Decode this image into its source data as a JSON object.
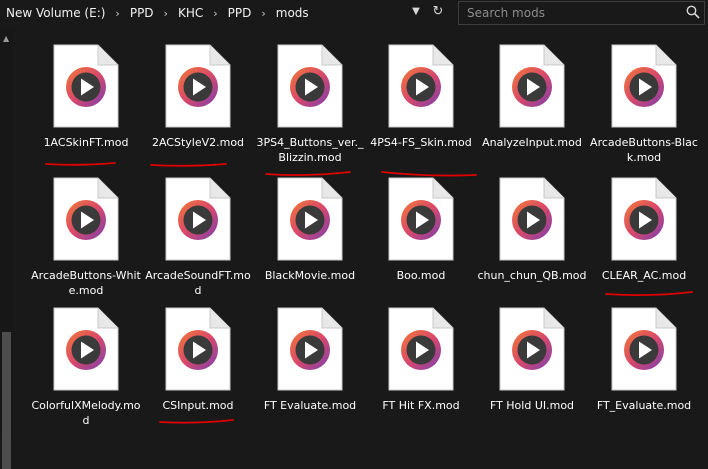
{
  "address_bar": {
    "crumbs": [
      "New Volume (E:)",
      "PPD",
      "KHC",
      "PPD",
      "mods"
    ],
    "dropdown_icon": "chevron-down-icon",
    "refresh_icon": "refresh-icon"
  },
  "search": {
    "placeholder": "Search mods",
    "icon": "search-icon"
  },
  "files": [
    {
      "label": "1ACSkinFT.mod",
      "underlined": true
    },
    {
      "label": "2ACStyleV2.mod",
      "underlined": true
    },
    {
      "label": "3PS4_Buttons_ver._Blizzin.mod",
      "underlined": true
    },
    {
      "label": "4PS4-FS_Skin.mod",
      "underlined": true
    },
    {
      "label": "AnalyzeInput.mod",
      "underlined": false
    },
    {
      "label": "ArcadeButtons-Black.mod",
      "underlined": false
    },
    {
      "label": "ArcadeButtons-White.mod",
      "underlined": false
    },
    {
      "label": "ArcadeSoundFT.mod",
      "underlined": false
    },
    {
      "label": "BlackMovie.mod",
      "underlined": false
    },
    {
      "label": "Boo.mod",
      "underlined": false
    },
    {
      "label": "chun_chun_QB.mod",
      "underlined": false
    },
    {
      "label": "CLEAR_AC.mod",
      "underlined": true
    },
    {
      "label": "ColorfulXMelody.mod",
      "underlined": false
    },
    {
      "label": "CSInput.mod",
      "underlined": true
    },
    {
      "label": "FT Evaluate.mod",
      "underlined": false
    },
    {
      "label": "FT Hit FX.mod",
      "underlined": false
    },
    {
      "label": "FT Hold UI.mod",
      "underlined": false
    },
    {
      "label": "FT_Evaluate.mod",
      "underlined": false
    }
  ],
  "file_icon": "media-file-icon",
  "colors": {
    "background": "#191919",
    "annotation": "#e00000",
    "icon_ring_orange": "#f27a35",
    "icon_ring_purple": "#7b3fb0"
  }
}
